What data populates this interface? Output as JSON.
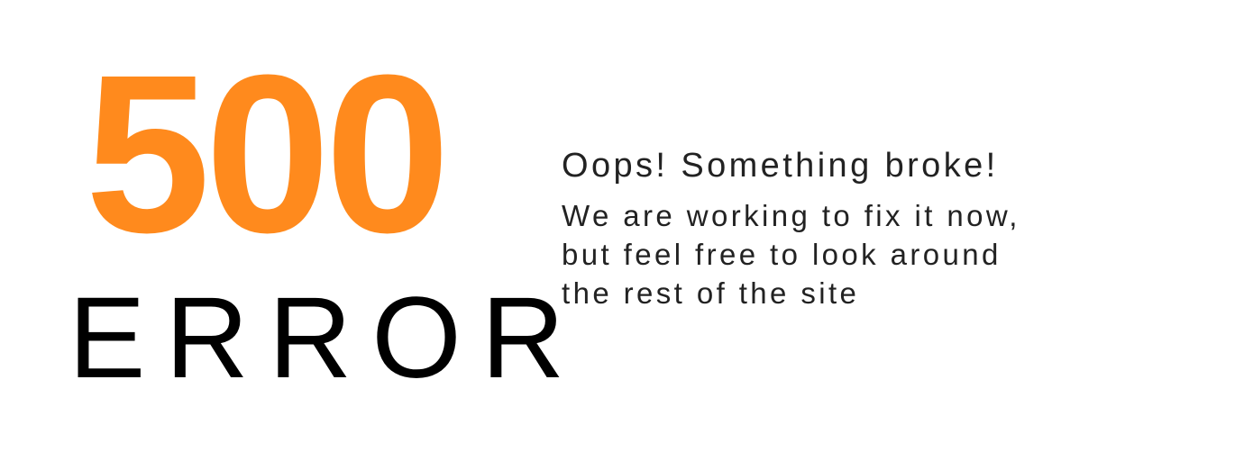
{
  "error": {
    "code": "500",
    "word": "ERROR"
  },
  "message": {
    "headline": "Oops! Something broke!",
    "lines": [
      "We are working to fix it now,",
      "but feel free to look around",
      "the rest of the site"
    ]
  },
  "colors": {
    "accent": "#ff8a1d",
    "text": "#000000",
    "body_text": "#222222",
    "background": "#ffffff"
  }
}
